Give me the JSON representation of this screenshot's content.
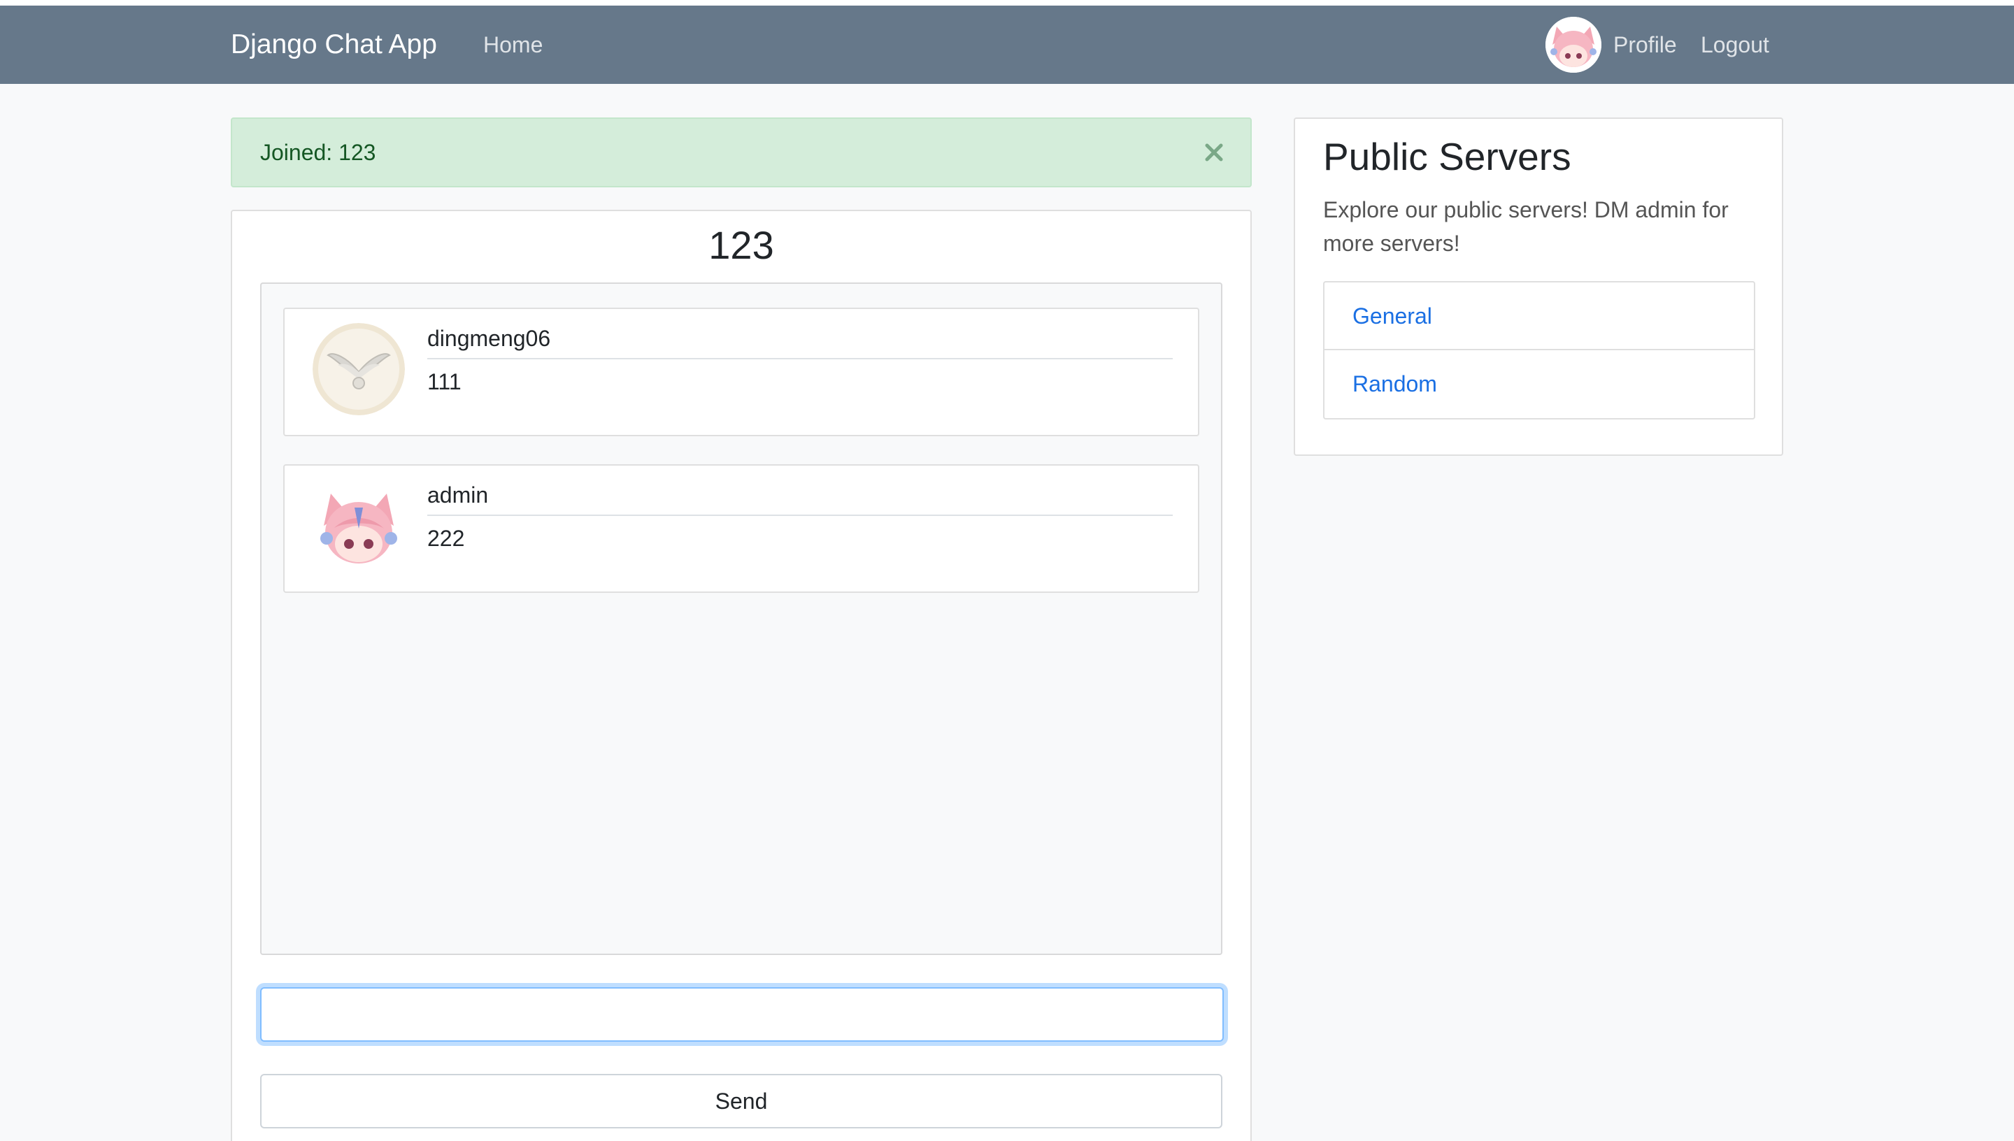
{
  "navbar": {
    "brand": "Django Chat App",
    "home": "Home",
    "profile": "Profile",
    "logout": "Logout",
    "background_color": "#66788a"
  },
  "alert": {
    "text": "Joined: 123",
    "close_icon": "close-icon",
    "background_color": "#d4edda"
  },
  "room": {
    "title": "123",
    "messages": [
      {
        "user": "dingmeng06",
        "text": "111",
        "avatar": "winged-emblem-avatar"
      },
      {
        "user": "admin",
        "text": "222",
        "avatar": "pink-haired-anime-girl-avatar"
      }
    ],
    "input_value": "",
    "send_label": "Send"
  },
  "sidebar": {
    "title": "Public Servers",
    "description": "Explore our public servers! DM admin for more servers!",
    "servers": [
      {
        "label": "General"
      },
      {
        "label": "Random"
      }
    ],
    "link_color": "#1a6fe3"
  }
}
